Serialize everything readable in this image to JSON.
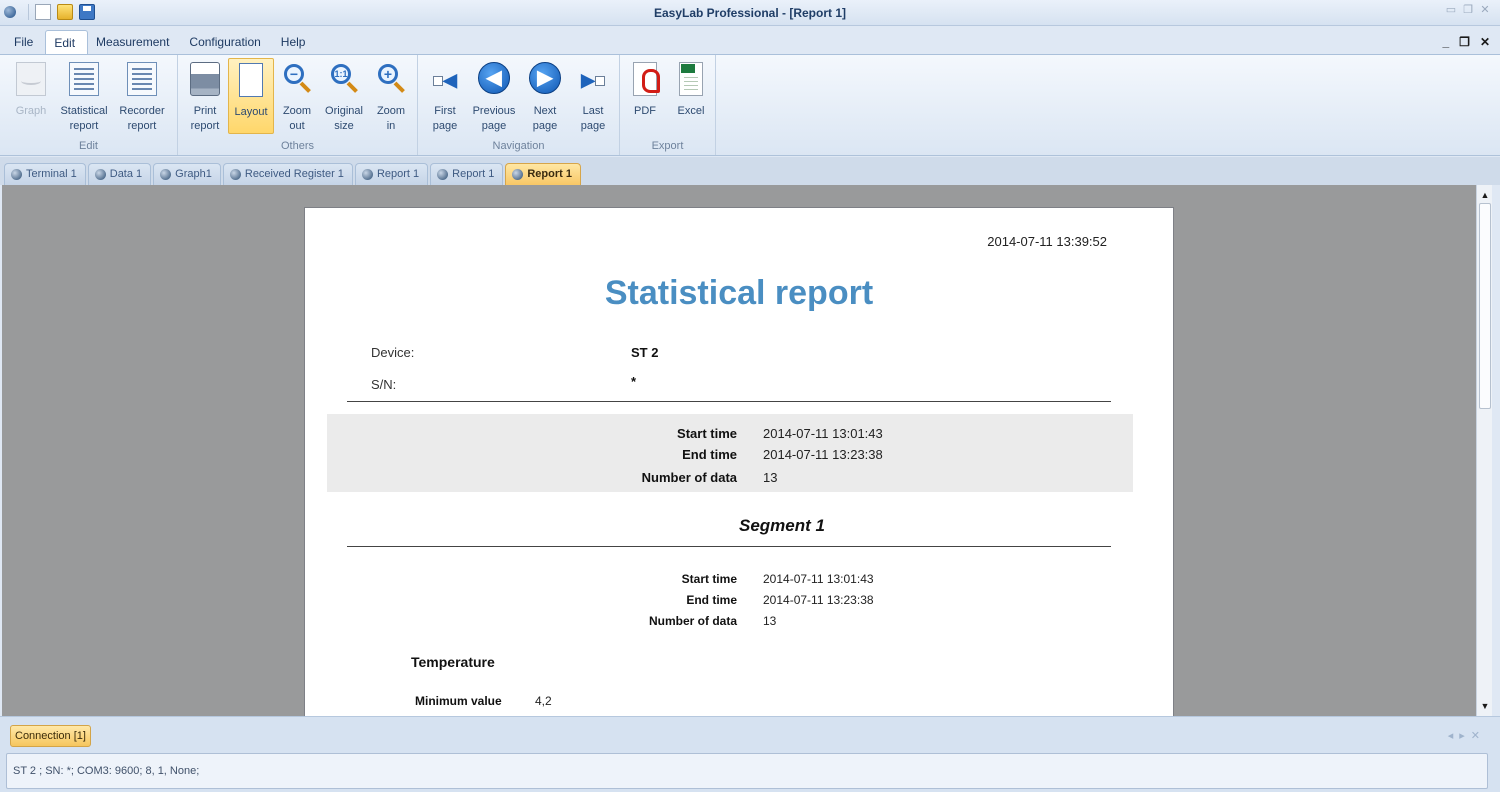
{
  "window": {
    "title": "EasyLab Professional - [Report 1]"
  },
  "menu": {
    "items": [
      "File",
      "Edit",
      "Measurement",
      "Configuration",
      "Help"
    ],
    "active": "Edit"
  },
  "ribbon": {
    "groups": [
      {
        "label": "Edit",
        "buttons": [
          {
            "label": "Graph",
            "icon": "graph-icon",
            "disabled": true
          },
          {
            "label": "Statistical\nreport",
            "icon": "statistical-report-icon"
          },
          {
            "label": "Recorder\nreport",
            "icon": "recorder-report-icon"
          }
        ]
      },
      {
        "label": "Others",
        "buttons": [
          {
            "label": "Print\nreport",
            "icon": "printer-icon"
          },
          {
            "label": "Layout",
            "icon": "layout-icon",
            "selected": true
          },
          {
            "label": "Zoom\nout",
            "icon": "zoom-out-icon"
          },
          {
            "label": "Original\nsize",
            "icon": "original-size-icon"
          },
          {
            "label": "Zoom\nin",
            "icon": "zoom-in-icon"
          }
        ]
      },
      {
        "label": "Navigation",
        "buttons": [
          {
            "label": "First\npage",
            "icon": "first-page-icon"
          },
          {
            "label": "Previous\npage",
            "icon": "previous-page-icon"
          },
          {
            "label": "Next\npage",
            "icon": "next-page-icon"
          },
          {
            "label": "Last\npage",
            "icon": "last-page-icon"
          }
        ]
      },
      {
        "label": "Export",
        "buttons": [
          {
            "label": "PDF",
            "icon": "pdf-icon"
          },
          {
            "label": "Excel",
            "icon": "excel-icon"
          }
        ]
      }
    ]
  },
  "tabs": [
    "Terminal 1",
    "Data 1",
    "Graph1",
    "Received Register 1",
    "Report 1",
    "Report 1",
    "Report 1"
  ],
  "active_tab": 6,
  "report": {
    "timestamp": "2014-07-11 13:39:52",
    "title": "Statistical report",
    "device_label": "Device:",
    "device_value": "ST 2",
    "sn_label": "S/N:",
    "sn_value": "*",
    "summary": {
      "start_label": "Start time",
      "start_value": "2014-07-11 13:01:43",
      "end_label": "End time",
      "end_value": "2014-07-11 13:23:38",
      "count_label": "Number of data",
      "count_value": "13"
    },
    "segment": {
      "title": "Segment 1",
      "dashes": "_ _ _ _ _ _ _ _ _ _ _ _ _ _ _ _ _ _",
      "start_label": "Start time",
      "start_value": "2014-07-11 13:01:43",
      "end_label": "End time",
      "end_value": "2014-07-11 13:23:38",
      "count_label": "Number of data",
      "count_value": "13"
    },
    "section": {
      "title": "Temperature",
      "min_label": "Minimum value",
      "min_value": "4,2"
    }
  },
  "bottom": {
    "tab": "Connection [1]",
    "status": "ST 2 ; SN: *; COM3: 9600; 8, 1, None;"
  },
  "colors": {
    "title_blue": "#4a8ec2",
    "active_tab": "#f8c766",
    "workspace": "#999a9b"
  }
}
